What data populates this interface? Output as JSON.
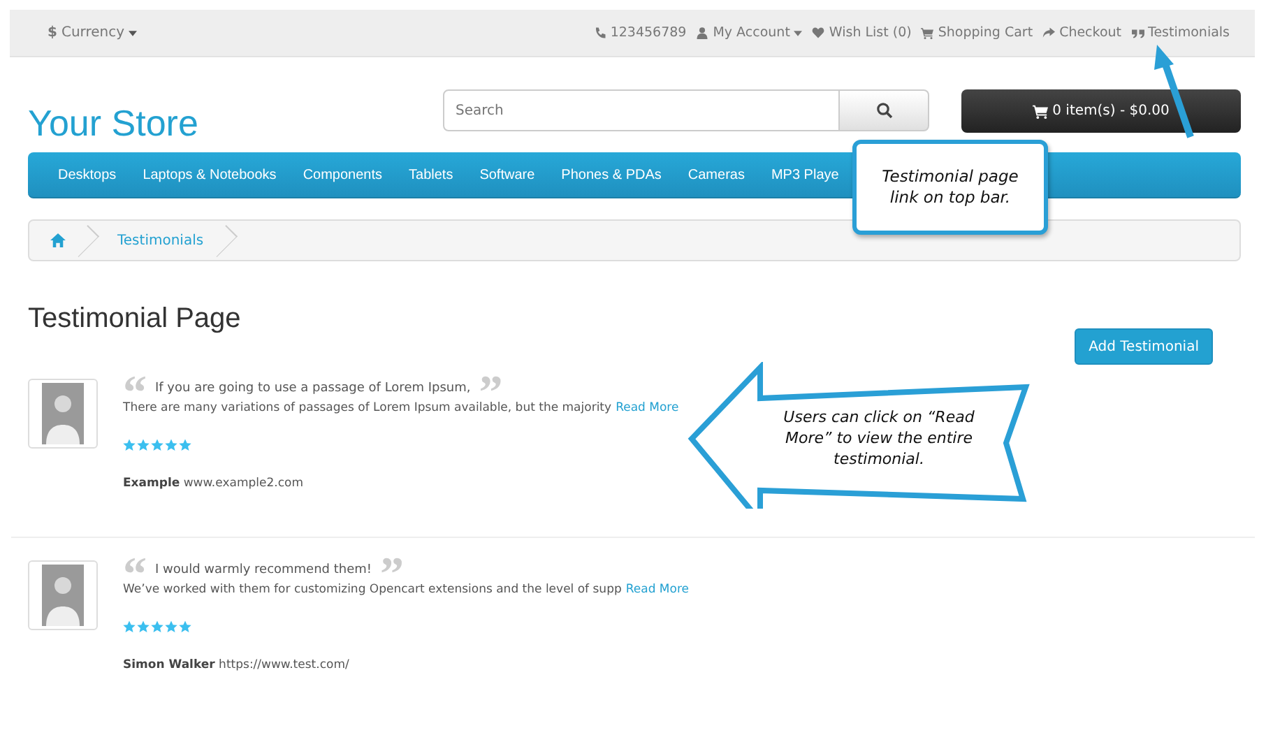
{
  "top_bar": {
    "currency": {
      "symbol": "$",
      "label": "Currency"
    },
    "links": [
      {
        "kind": "phone",
        "label": "123456789",
        "dropdown": false
      },
      {
        "kind": "account",
        "label": "My Account",
        "dropdown": true
      },
      {
        "kind": "wishlist",
        "label": "Wish List (0)",
        "dropdown": false
      },
      {
        "kind": "cart",
        "label": "Shopping Cart",
        "dropdown": false
      },
      {
        "kind": "checkout",
        "label": "Checkout",
        "dropdown": false
      },
      {
        "kind": "testimonials",
        "label": "Testimonials",
        "dropdown": false
      }
    ]
  },
  "header": {
    "logo": "Your Store",
    "search": {
      "placeholder": "Search"
    },
    "cart_button": "0 item(s) - $0.00"
  },
  "menu": [
    "Desktops",
    "Laptops & Notebooks",
    "Components",
    "Tablets",
    "Software",
    "Phones & PDAs",
    "Cameras",
    "MP3 Playe"
  ],
  "breadcrumb": [
    "Testimonials"
  ],
  "page_title": "Testimonial Page",
  "add_button": "Add Testimonial",
  "testimonials": [
    {
      "open_quote": "“",
      "headline": "If you are going to use a passage of Lorem Ipsum,",
      "close_quote": "”",
      "excerpt": "There are many variations of passages of Lorem Ipsum available, but the majority",
      "read_more": "Read More",
      "stars": 5,
      "author": "Example",
      "url": "www.example2.com"
    },
    {
      "open_quote": "“",
      "headline": "I would warmly recommend them!",
      "close_quote": "”",
      "excerpt": "We’ve worked with them for customizing Opencart extensions and the level of supp",
      "read_more": "Read More",
      "stars": 5,
      "author": "Simon Walker",
      "url": "https://www.test.com/"
    }
  ],
  "annotations": [
    {
      "kind": "bubble",
      "text": "Testimonial page link on top bar."
    },
    {
      "kind": "arrow",
      "text": "Users can click on “Read More” to view the entire testimonial."
    }
  ]
}
